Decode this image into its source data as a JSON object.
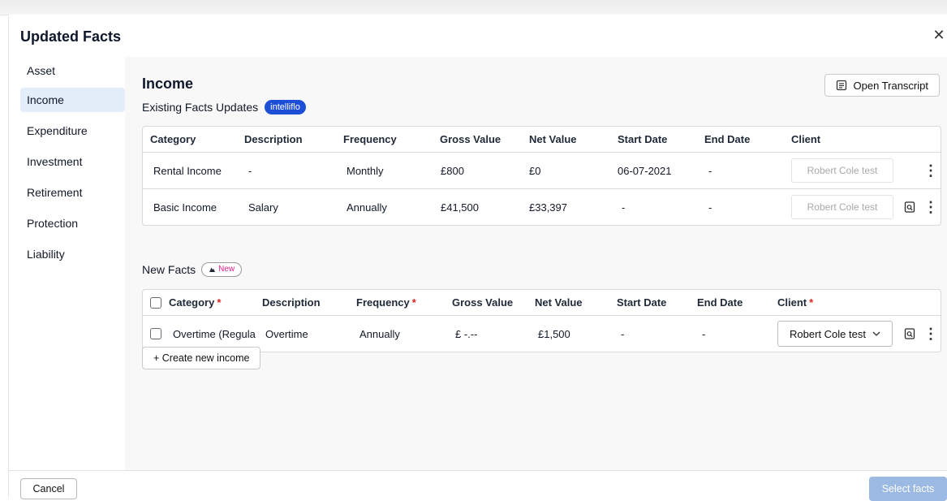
{
  "modal": {
    "title": "Updated Facts"
  },
  "sidebar": {
    "items": [
      {
        "label": "Asset"
      },
      {
        "label": "Income"
      },
      {
        "label": "Expenditure"
      },
      {
        "label": "Investment"
      },
      {
        "label": "Retirement"
      },
      {
        "label": "Protection"
      },
      {
        "label": "Liability"
      }
    ],
    "active": "Income"
  },
  "section": {
    "title": "Income",
    "existing_label": "Existing Facts Updates",
    "existing_badge": "intelliflo",
    "open_transcript": "Open Transcript"
  },
  "existing_table": {
    "headers": [
      "Category",
      "Description",
      "Frequency",
      "Gross Value",
      "Net Value",
      "Start Date",
      "End Date",
      "Client"
    ],
    "rows": [
      {
        "category": "Rental Income",
        "description": "-",
        "frequency": "Monthly",
        "gross": "£800",
        "net": "£0",
        "start": "06-07-2021",
        "end": "-",
        "client": "Robert Cole test"
      },
      {
        "category": "Basic Income",
        "description": "Salary",
        "frequency": "Annually",
        "gross": "£41,500",
        "net": "£33,397",
        "start": "-",
        "end": "-",
        "client": "Robert Cole test"
      }
    ]
  },
  "new_facts": {
    "label": "New Facts",
    "badge": "New",
    "headers": [
      "Category",
      "Description",
      "Frequency",
      "Gross Value",
      "Net Value",
      "Start Date",
      "End Date",
      "Client"
    ],
    "rows": [
      {
        "category": "Overtime (Regula",
        "description": "Overtime",
        "frequency": "Annually",
        "gross": "£ -.--",
        "net": "£1,500",
        "start": "-",
        "end": "-",
        "client": "Robert Cole test"
      }
    ],
    "create_button": "+ Create new income"
  },
  "footer": {
    "cancel": "Cancel",
    "select": "Select facts"
  },
  "colors": {
    "accent": "#1d4ed8",
    "active_bg": "#e4eefb",
    "disabled_btn": "#9bb9e2",
    "required": "#dc2626",
    "new_badge": "#e11d8a"
  }
}
